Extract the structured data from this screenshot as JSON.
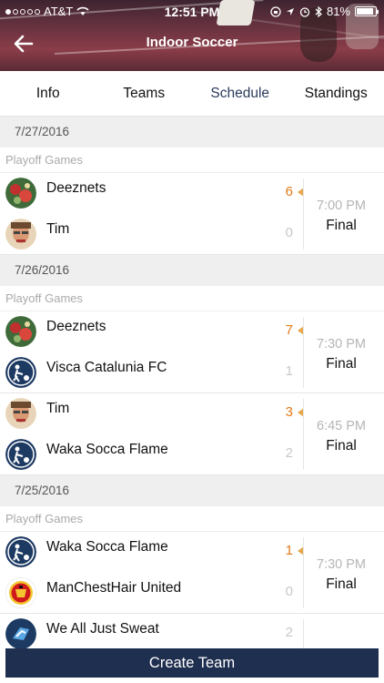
{
  "status_bar": {
    "carrier": "AT&T",
    "time": "12:51 PM",
    "battery": "81%"
  },
  "header": {
    "title": "Indoor Soccer"
  },
  "tabs": [
    {
      "label": "Info",
      "active": false
    },
    {
      "label": "Teams",
      "active": false
    },
    {
      "label": "Schedule",
      "active": true
    },
    {
      "label": "Standings",
      "active": false
    }
  ],
  "schedule": [
    {
      "date": "7/27/2016",
      "section": "Playoff Games",
      "games": [
        {
          "teams": [
            {
              "name": "Deeznets",
              "score": "6",
              "winner": true,
              "avatar": "holiday-ornaments"
            },
            {
              "name": "Tim",
              "score": "0",
              "winner": false,
              "avatar": "person-photo"
            }
          ],
          "time": "7:00 PM",
          "status": "Final"
        }
      ]
    },
    {
      "date": "7/26/2016",
      "section": "Playoff Games",
      "games": [
        {
          "teams": [
            {
              "name": "Deeznets",
              "score": "7",
              "winner": true,
              "avatar": "holiday-ornaments"
            },
            {
              "name": "Visca Catalunia FC",
              "score": "1",
              "winner": false,
              "avatar": "soccer-logo"
            }
          ],
          "time": "7:30 PM",
          "status": "Final"
        },
        {
          "teams": [
            {
              "name": "Tim",
              "score": "3",
              "winner": true,
              "avatar": "person-photo"
            },
            {
              "name": "Waka Socca Flame",
              "score": "2",
              "winner": false,
              "avatar": "soccer-logo"
            }
          ],
          "time": "6:45 PM",
          "status": "Final"
        }
      ]
    },
    {
      "date": "7/25/2016",
      "section": "Playoff Games",
      "games": [
        {
          "teams": [
            {
              "name": "Waka Socca Flame",
              "score": "1",
              "winner": true,
              "avatar": "soccer-logo"
            },
            {
              "name": "ManChestHair United",
              "score": "0",
              "winner": false,
              "avatar": "club-crest"
            }
          ],
          "time": "7:30 PM",
          "status": "Final"
        },
        {
          "teams": [
            {
              "name": "We All Just Sweat",
              "score": "2",
              "winner": false,
              "avatar": "blue-badge"
            }
          ],
          "time": "",
          "status": ""
        }
      ]
    }
  ],
  "footer": {
    "create_button_label": "Create Team"
  },
  "colors": {
    "tab_active": "#2a3b5c",
    "winner_score": "#e27a1b",
    "button_bg": "#1f2f4f"
  }
}
